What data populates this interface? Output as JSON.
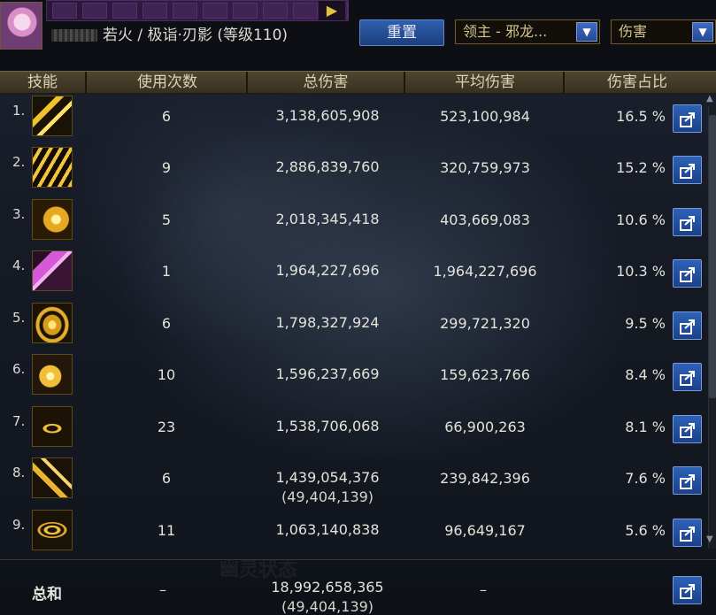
{
  "header": {
    "player_prefix": "若火",
    "separator": "/",
    "class_info": "极诣·刃影 (等级110)",
    "reset_label": "重置",
    "boss_select": "领主 - 邪龙...",
    "metric_select": "伤害",
    "dropdown_arrow": "▼"
  },
  "columns": {
    "skill": "技能",
    "uses": "使用次数",
    "total": "总伤害",
    "avg": "平均伤害",
    "pct": "伤害占比"
  },
  "rows": [
    {
      "rank": "1.",
      "uses": "6",
      "total": "3,138,605,908",
      "sub": "",
      "avg": "523,100,984",
      "pct": "16.5 %",
      "icon": "yellow-slash-skill-icon"
    },
    {
      "rank": "2.",
      "uses": "9",
      "total": "2,886,839,760",
      "sub": "",
      "avg": "320,759,973",
      "pct": "15.2 %",
      "icon": "yellow-stripes-skill-icon"
    },
    {
      "rank": "3.",
      "uses": "5",
      "total": "2,018,345,418",
      "sub": "",
      "avg": "403,669,083",
      "pct": "10.6 %",
      "icon": "yellow-burst-skill-icon"
    },
    {
      "rank": "4.",
      "uses": "1",
      "total": "1,964,227,696",
      "sub": "",
      "avg": "1,964,227,696",
      "pct": "10.3 %",
      "icon": "purple-pink-skill-icon"
    },
    {
      "rank": "5.",
      "uses": "6",
      "total": "1,798,327,924",
      "sub": "",
      "avg": "299,721,320",
      "pct": "9.5 %",
      "icon": "yellow-swirl-skill-icon"
    },
    {
      "rank": "6.",
      "uses": "10",
      "total": "1,596,237,669",
      "sub": "",
      "avg": "159,623,766",
      "pct": "8.4 %",
      "icon": "yellow-flare-skill-icon"
    },
    {
      "rank": "7.",
      "uses": "23",
      "total": "1,538,706,068",
      "sub": "",
      "avg": "66,900,263",
      "pct": "8.1 %",
      "icon": "yellow-ring-skill-icon"
    },
    {
      "rank": "8.",
      "uses": "6",
      "total": "1,439,054,376",
      "sub": "(49,404,139)",
      "avg": "239,842,396",
      "pct": "7.6 %",
      "icon": "yellow-arc-skill-icon"
    },
    {
      "rank": "9.",
      "uses": "11",
      "total": "1,063,140,838",
      "sub": "",
      "avg": "96,649,167",
      "pct": "5.6 %",
      "icon": "yellow-wave-skill-icon"
    }
  ],
  "total": {
    "label": "总和",
    "uses": "–",
    "damage": "18,992,658,365",
    "damage_sub": "(49,404,139)",
    "avg": "–"
  },
  "watermark": "幽灵状态",
  "colors": {
    "accent_blue": "#2c62b8",
    "header_gold": "#4e4630",
    "skill_gold": "#e8b526"
  }
}
